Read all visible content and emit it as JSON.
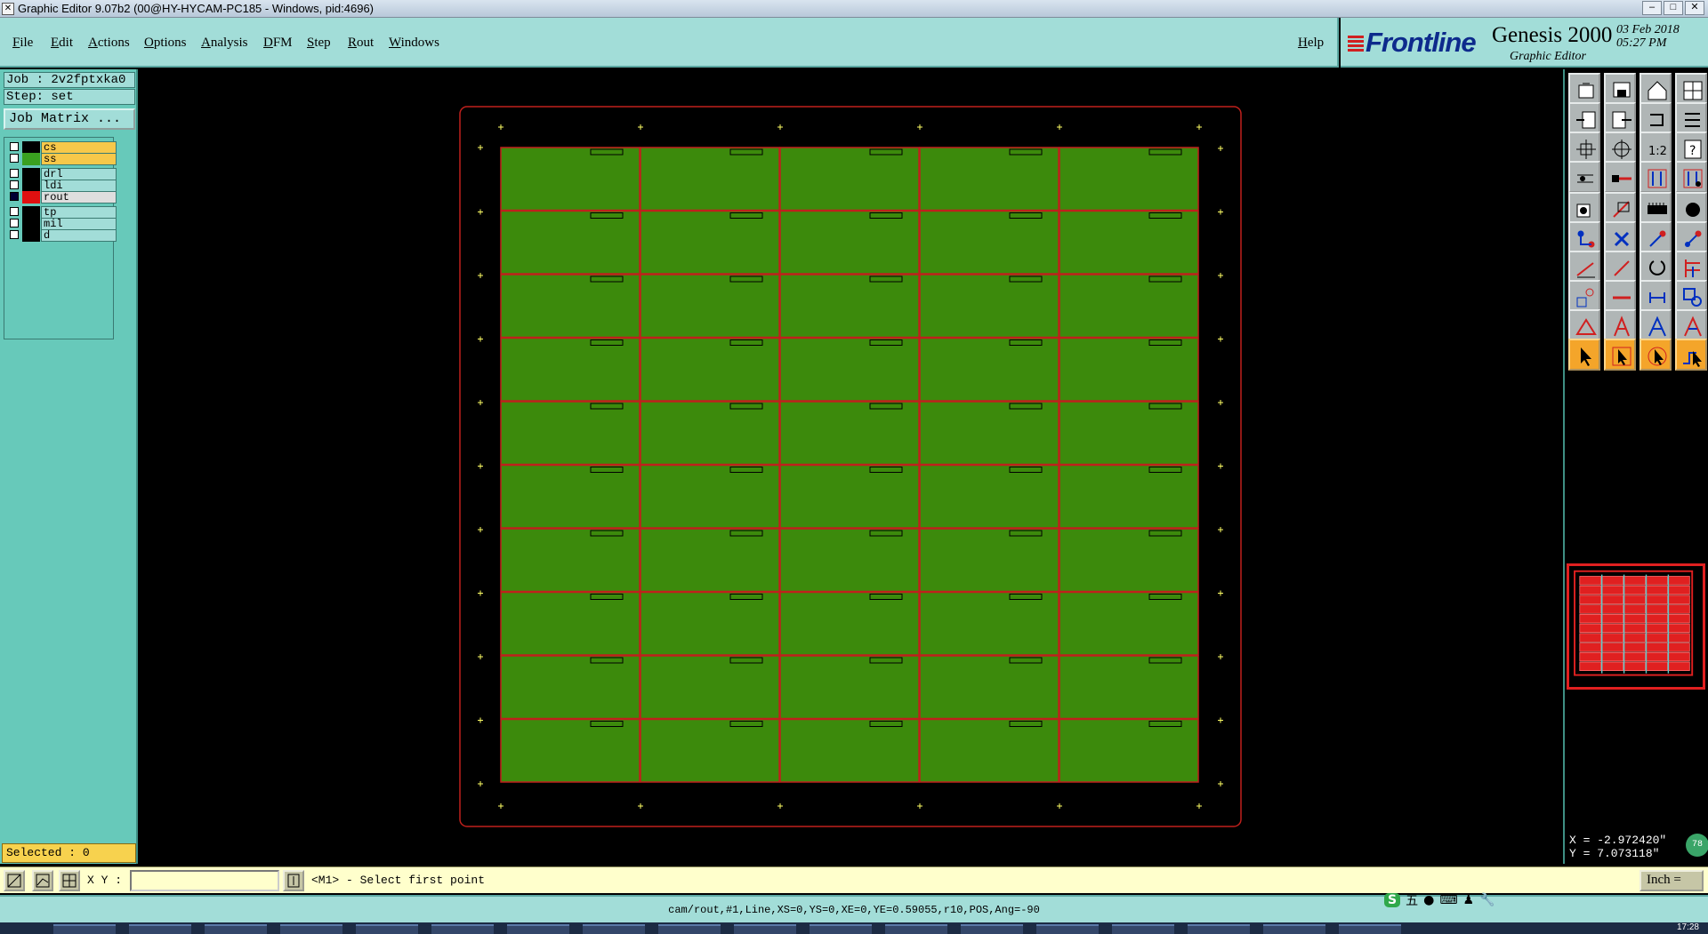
{
  "window": {
    "title": "Graphic Editor 9.07b2 (00@HY-HYCAM-PC185 - Windows, pid:4696)",
    "controls": [
      "–",
      "□",
      "✕"
    ]
  },
  "menu": {
    "items": [
      "File",
      "Edit",
      "Actions",
      "Options",
      "Analysis",
      "DFM",
      "Step",
      "Rout",
      "Windows"
    ],
    "help": "Help"
  },
  "brand": {
    "logo": "Frontline",
    "product": "Genesis 2000",
    "subtitle": "Graphic Editor",
    "date": "03 Feb 2018",
    "time": "05:27 PM"
  },
  "job": {
    "job_label": "Job : 2v2fptxka0",
    "step_label": "Step: set",
    "matrix_button": "Job Matrix ..."
  },
  "layers": [
    {
      "name": "cs",
      "color": "#f7c84a",
      "swatch": "#000000",
      "group": 0
    },
    {
      "name": "ss",
      "color": "#f7c84a",
      "swatch": "#3aa020",
      "group": 0
    },
    {
      "name": "drl",
      "color": "#a2ddd8",
      "swatch": "#000000",
      "group": 1
    },
    {
      "name": "ldi",
      "color": "#a2ddd8",
      "swatch": "#000000",
      "group": 1
    },
    {
      "name": "rout",
      "color": "#dedede",
      "swatch": "#e01010",
      "group": 1,
      "active": true
    },
    {
      "name": "tp",
      "color": "#a2ddd8",
      "swatch": "#000000",
      "group": 2
    },
    {
      "name": "mil",
      "color": "#a2ddd8",
      "swatch": "#000000",
      "group": 2
    },
    {
      "name": "d",
      "color": "#a2ddd8",
      "swatch": "#000000",
      "group": 2
    }
  ],
  "selected_label": "Selected : 0",
  "panel": {
    "cols": 5,
    "rows": 10,
    "pcb_color": "#3c8a0c",
    "rout_color": "#c0201c",
    "marker_color": "#ffff66"
  },
  "coords": {
    "x": "X = -2.972420\"",
    "y": "Y = 7.073118\"",
    "badge": "78"
  },
  "command": {
    "xy_label": "X Y :",
    "xy_value": "",
    "prompt": "<M1> - Select first point",
    "unit": "Inch ="
  },
  "status": "cam/rout,#1,Line,XS=0,YS=0,XE=0,YE=0.59055,r10,POS,Ang=-90",
  "ime": [
    "S",
    "五",
    "●",
    "⌨",
    "♟",
    "🔧"
  ],
  "taskbar_clock": "17:28",
  "tools": [
    "open-job-icon",
    "save-icon",
    "home-icon",
    "layout-icon",
    "import-icon",
    "export-icon",
    "flip-icon",
    "split-icon",
    "zoom-fit-icon",
    "pan-icon",
    "scale-icon",
    "help-icon",
    "measure-icon",
    "connect-icon",
    "matrix-icon",
    "matrix-alt-icon",
    "pad-icon",
    "clip-icon",
    "ruler-icon",
    "dot-icon",
    "node-icon",
    "cross-icon",
    "move-icon",
    "copy-icon",
    "line-icon",
    "arc-icon",
    "rotate-icon",
    "step-repeat-icon",
    "snap-icon",
    "minus-icon",
    "bracket-icon",
    "multi-icon",
    "tri-icon",
    "letter-a-icon",
    "letter-a2-icon",
    "letter-a3-icon",
    "pointer-icon",
    "pointer-box-icon",
    "pointer-circle-icon",
    "pointer-net-icon"
  ]
}
